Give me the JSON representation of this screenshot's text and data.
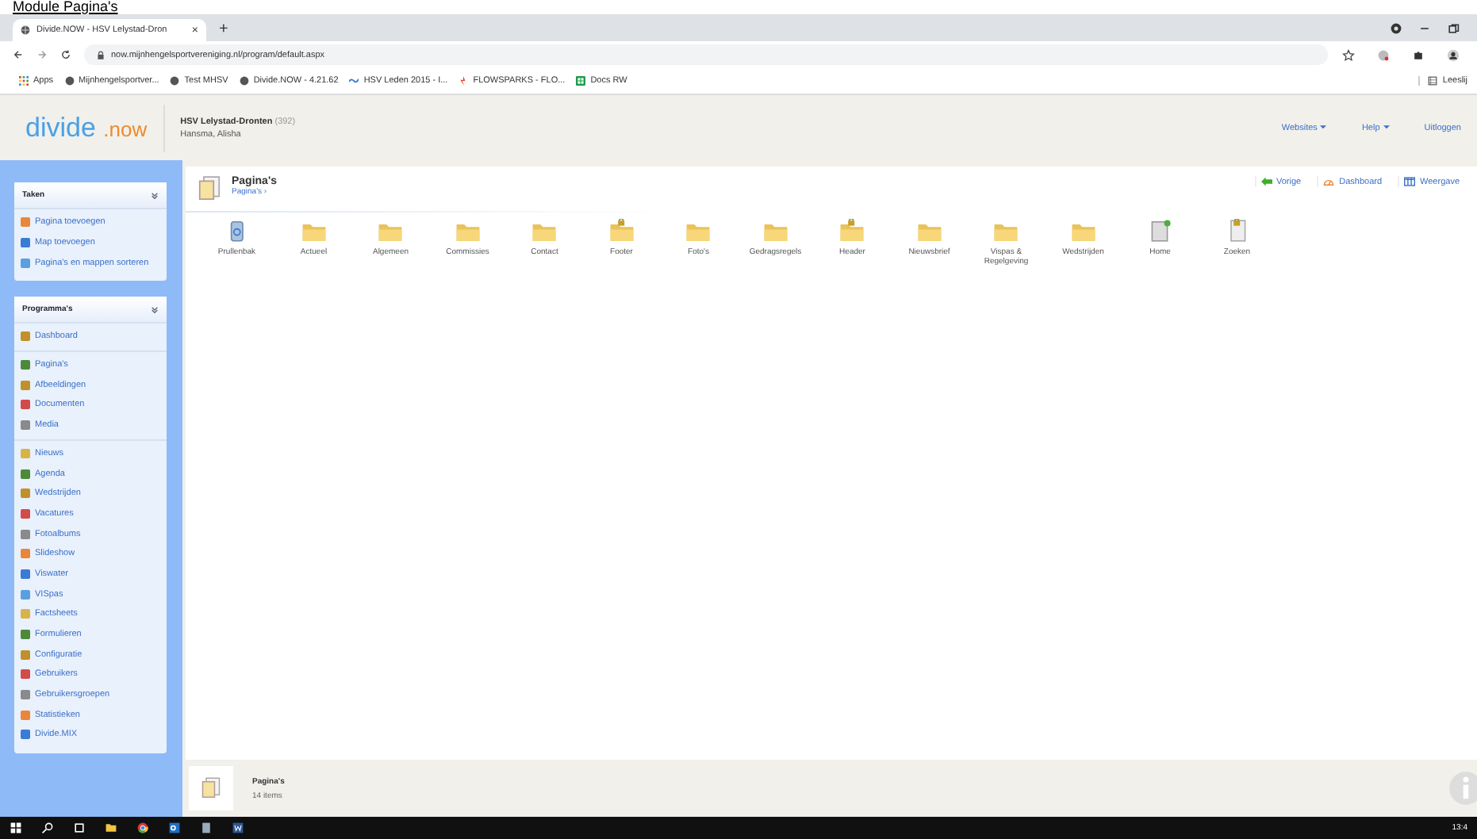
{
  "heading": "Module Pagina's",
  "browser": {
    "tab": {
      "title": "Divide.NOW - HSV Lelystad-Dron",
      "close": "×"
    },
    "new_tab": "+",
    "address": "now.mijnhengelsportvereniging.nl/program/default.aspx",
    "bookmarks": [
      "Apps",
      "Mijnhengelsportver...",
      "Test MHSV",
      "Divide.NOW - 4.21.62",
      "HSV Leden 2015 - I...",
      "FLOWSPARKS - FLO...",
      "Docs RW"
    ],
    "reading_list": "Leeslij"
  },
  "header": {
    "logo_main": "divide",
    "logo_suffix": ".now",
    "organisation": "HSV Lelystad-Dronten",
    "org_count": "(392)",
    "user": "Hansma, Alisha",
    "menu": [
      {
        "label": "Websites",
        "dropdown": true
      },
      {
        "label": "Help",
        "dropdown": true
      },
      {
        "label": "Uitloggen",
        "dropdown": false
      }
    ]
  },
  "sidebar": {
    "panels": [
      {
        "title": "Taken",
        "groups": [
          [
            "Pagina toevoegen",
            "Map toevoegen",
            "Pagina's en mappen sorteren"
          ]
        ]
      },
      {
        "title": "Programma's",
        "groups": [
          [
            "Dashboard"
          ],
          [
            "Pagina's",
            "Afbeeldingen",
            "Documenten",
            "Media"
          ],
          [
            "Nieuws",
            "Agenda",
            "Wedstrijden",
            "Vacatures",
            "Fotoalbums",
            "Slideshow",
            "Viswater",
            "VISpas",
            "Factsheets",
            "Formulieren",
            "Configuratie",
            "Gebruikers",
            "Gebruikersgroepen",
            "Statistieken",
            "Divide.MIX"
          ]
        ]
      }
    ]
  },
  "page": {
    "title": "Pagina's",
    "breadcrumb": "Pagina's",
    "breadcrumb_sep": "›",
    "actions": [
      {
        "kind": "back",
        "label": "Vorige"
      },
      {
        "kind": "dashboard",
        "label": "Dashboard"
      },
      {
        "kind": "view",
        "label": "Weergave"
      }
    ],
    "items": [
      {
        "kind": "trash",
        "label": "Prullenbak",
        "locked": false
      },
      {
        "kind": "folder",
        "label": "Actueel",
        "locked": false
      },
      {
        "kind": "folder",
        "label": "Algemeen",
        "locked": false
      },
      {
        "kind": "folder",
        "label": "Commissies",
        "locked": false
      },
      {
        "kind": "folder",
        "label": "Contact",
        "locked": false
      },
      {
        "kind": "folder",
        "label": "Footer",
        "locked": true
      },
      {
        "kind": "folder",
        "label": "Foto's",
        "locked": false
      },
      {
        "kind": "folder",
        "label": "Gedragsregels",
        "locked": false
      },
      {
        "kind": "folder",
        "label": "Header",
        "locked": true
      },
      {
        "kind": "folder",
        "label": "Nieuwsbrief",
        "locked": false
      },
      {
        "kind": "folder",
        "label": "Vispas & Regelgeving",
        "locked": false
      },
      {
        "kind": "folder",
        "label": "Wedstrijden",
        "locked": false
      },
      {
        "kind": "homepage",
        "label": "Home",
        "locked": false
      },
      {
        "kind": "page",
        "label": "Zoeken",
        "locked": true
      }
    ]
  },
  "footer": {
    "title": "Pagina's",
    "count": "14 items"
  },
  "taskbar": {
    "clock": "13:4"
  }
}
